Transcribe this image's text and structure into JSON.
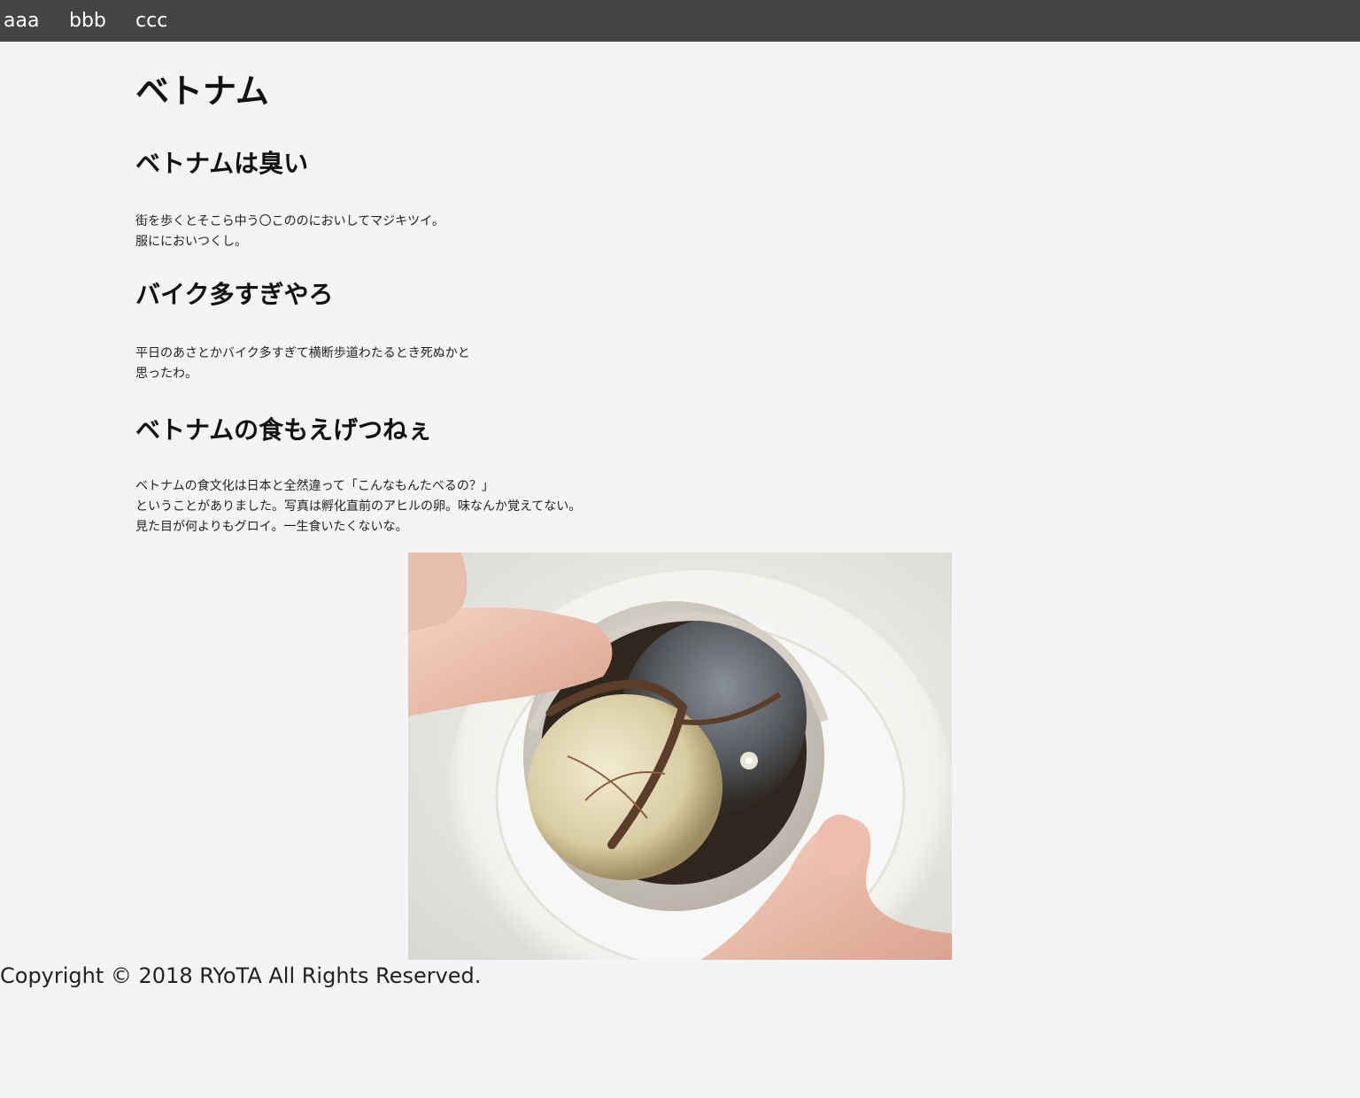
{
  "nav": {
    "items": [
      {
        "label": "aaa"
      },
      {
        "label": "bbb"
      },
      {
        "label": "ccc"
      }
    ]
  },
  "page": {
    "title": "ベトナム",
    "sections": [
      {
        "heading": "ベトナムは臭い",
        "lines": [
          "街を歩くとそこら中う〇こののにおいしてマジキツイ。",
          "服ににおいつくし。"
        ]
      },
      {
        "heading": "バイク多すぎやろ",
        "lines": [
          "平日のあさとかバイク多すぎて横断歩道わたるとき死ぬかと",
          "思ったわ。"
        ]
      },
      {
        "heading": "ベトナムの食もえげつねぇ",
        "lines": [
          "ベトナムの食文化は日本と全然違って「こんなもんたべるの？」",
          "ということがありました。写真は孵化直前のアヒルの卵。味なんか覚えてない。",
          "見た目が何よりもグロイ。一生食いたくないな。"
        ]
      }
    ]
  },
  "footer": {
    "copyright": "Copyright © 2018 RYoTA All Rights Reserved."
  },
  "colors": {
    "nav_background": "#454545",
    "page_background": "#f3f4f6",
    "nav_text": "#ffffff"
  }
}
